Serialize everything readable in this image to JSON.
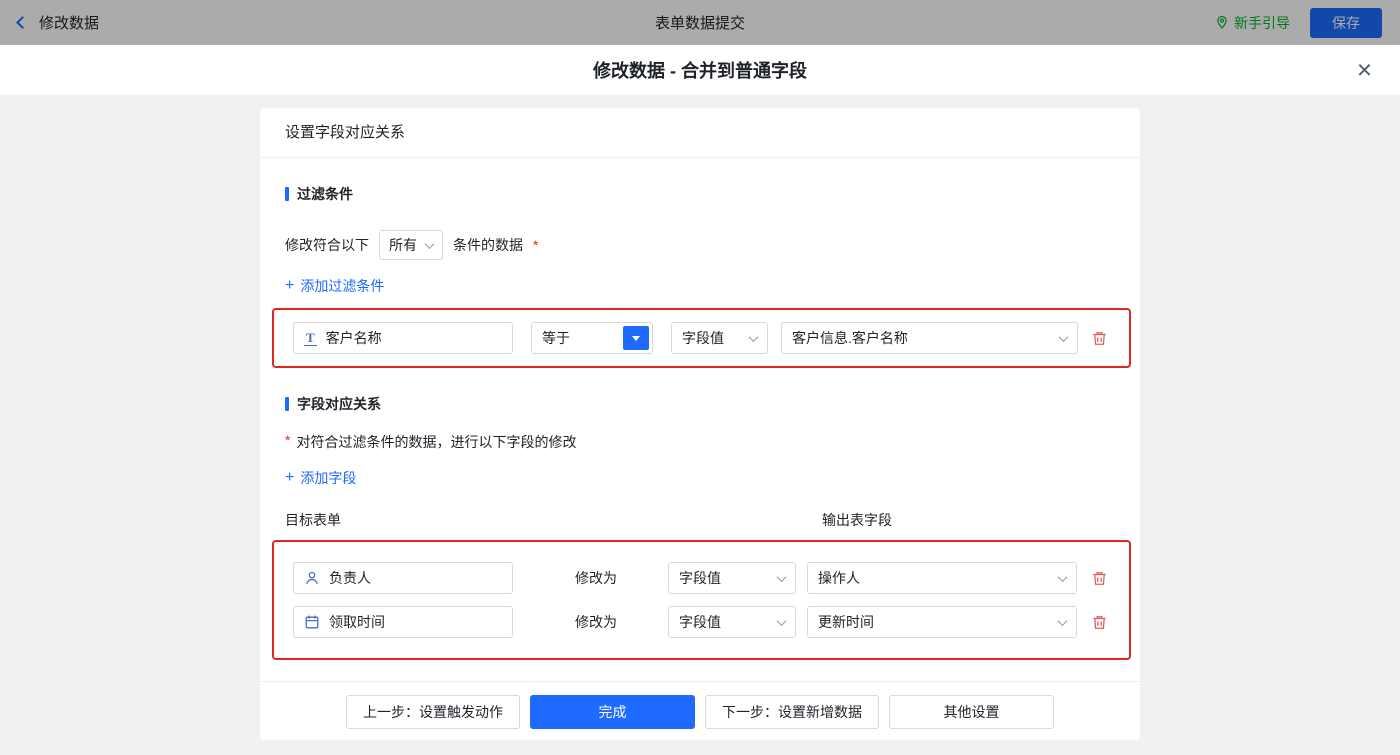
{
  "topbar": {
    "back_label": "修改数据",
    "title": "表单数据提交",
    "guide_label": "新手引导",
    "save_label": "保存"
  },
  "modal": {
    "title": "修改数据 - 合并到普通字段",
    "close_glyph": "×"
  },
  "card": {
    "header_title": "设置字段对应关系",
    "filter": {
      "section_title": "过滤条件",
      "line_prefix": "修改符合以下",
      "match_value": "所有",
      "line_suffix": "条件的数据",
      "required_mark": "*",
      "plus_glyph": "+",
      "add_label": "添加过滤条件",
      "row": {
        "field": "客户名称",
        "operator": "等于",
        "value_type": "字段值",
        "value": "客户信息.客户名称"
      }
    },
    "mapping": {
      "section_title": "字段对应关系",
      "required_mark": "*",
      "description": "对符合过滤条件的数据，进行以下字段的修改",
      "plus_glyph": "+",
      "add_label": "添加字段",
      "col_target": "目标表单",
      "col_output": "输出表字段",
      "modify_label": "修改为",
      "rows": [
        {
          "field": "负责人",
          "icon": "user-icon",
          "value_type": "字段值",
          "value": "操作人"
        },
        {
          "field": "领取时间",
          "icon": "calendar-icon",
          "value_type": "字段值",
          "value": "更新时间"
        }
      ]
    },
    "footer": {
      "prev_label": "上一步：设置触发动作",
      "done_label": "完成",
      "next_label": "下一步：设置新增数据",
      "other_label": "其他设置"
    }
  },
  "icons": {
    "field_text": "T"
  },
  "colors": {
    "accent_blue": "#1f6bff",
    "success_green": "#00b42a",
    "highlight_red": "#e0261c",
    "danger_red": "#e05c5c"
  }
}
